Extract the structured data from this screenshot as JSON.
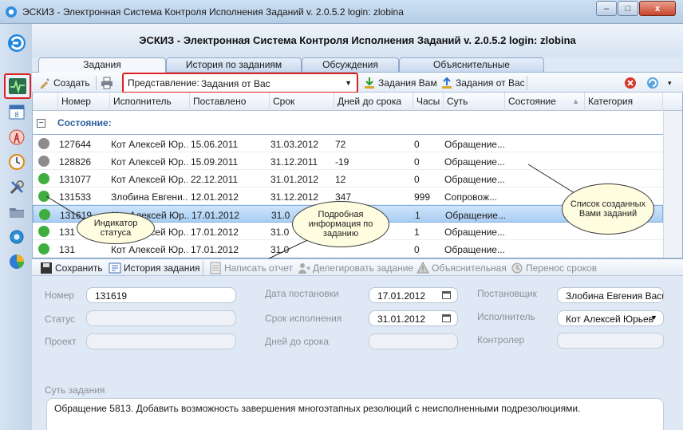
{
  "window": {
    "title": "ЭСКИЗ - Электронная Система Контроля Исполнения Заданий v. 2.0.5.2 login: zlobina",
    "min": "‒",
    "max": "□",
    "close": "x"
  },
  "header": {
    "title": "ЭСКИЗ - Электронная Система Контроля Исполнения Заданий v. 2.0.5.2 login: zlobina"
  },
  "sidebar": {
    "items": [
      {
        "icon": "activity-monitor-icon",
        "active": true
      },
      {
        "icon": "calendar-icon"
      },
      {
        "icon": "antenna-icon"
      },
      {
        "icon": "clock-icon"
      },
      {
        "icon": "tools-icon"
      },
      {
        "icon": "folder-icon"
      },
      {
        "icon": "gear-icon"
      },
      {
        "icon": "pie-chart-icon"
      }
    ]
  },
  "tabs": [
    "Задания",
    "История по заданиям",
    "Обсуждения",
    "Объяснительные"
  ],
  "toolbar": {
    "create": "Создать",
    "view_label": "Представление:",
    "view_value": "Задания от Вас",
    "tasks_to_you": "Задания Вам",
    "tasks_from_you": "Задания от Вас"
  },
  "grid": {
    "columns": [
      "Номер",
      "Исполнитель",
      "Поставлено",
      "Срок",
      "Дней до срока",
      "Часы",
      "Суть",
      "Состояние",
      "Категория"
    ],
    "group_label": "Состояние:",
    "rows": [
      {
        "status": "paused",
        "number": "127644",
        "executor": "Кот Алексей Юр...",
        "set": "15.06.2011",
        "due": "31.03.2012",
        "days": "72",
        "hours": "0",
        "essence": "Обращение..."
      },
      {
        "status": "paused",
        "number": "128826",
        "executor": "Кот Алексей Юр...",
        "set": "15.09.2011",
        "due": "31.12.2011",
        "days": "-19",
        "hours": "0",
        "essence": "Обращение..."
      },
      {
        "status": "active",
        "number": "131077",
        "executor": "Кот Алексей Юр...",
        "set": "22.12.2011",
        "due": "31.01.2012",
        "days": "12",
        "hours": "0",
        "essence": "Обращение..."
      },
      {
        "status": "active",
        "number": "131533",
        "executor": "Злобина Евгени...",
        "set": "12.01.2012",
        "due": "31.12.2012",
        "days": "347",
        "hours": "999",
        "essence": "Сопровож..."
      },
      {
        "status": "active",
        "number": "131619",
        "executor": "Кот Алексей Юр...",
        "set": "17.01.2012",
        "due": "31.0",
        "days": "",
        "hours": "1",
        "essence": "Обращение...",
        "selected": true
      },
      {
        "status": "active",
        "number": "131",
        "executor": "Кот Алексей Юр...",
        "set": "17.01.2012",
        "due": "31.0",
        "days": "",
        "hours": "1",
        "essence": "Обращение..."
      },
      {
        "status": "active",
        "number": "131",
        "executor": "Кот Алексей Юр...",
        "set": "17.01.2012",
        "due": "31.0",
        "days": "",
        "hours": "0",
        "essence": "Обращение..."
      }
    ]
  },
  "callouts": {
    "status_indicator": "Индикатор статуса",
    "details": "Подробная информация по заданию",
    "created_list": "Список созданных Вами заданий"
  },
  "detail_toolbar": {
    "save": "Сохранить",
    "history": "История задания",
    "write_report": "Написать отчет",
    "delegate": "Делегировать задание",
    "explanatory": "Объяснительная",
    "reschedule": "Перенос сроков"
  },
  "form": {
    "number_label": "Номер",
    "number_value": "131619",
    "status_label": "Статус",
    "project_label": "Проект",
    "date_set_label": "Дата постановки",
    "date_set_value": "17.01.2012",
    "deadline_label": "Срок исполнения",
    "deadline_value": "31.01.2012",
    "days_left_label": "Дней до срока",
    "setter_label": "Постановщик",
    "setter_value": "Злобина Евгения Васи",
    "executor_label": "Исполнитель",
    "executor_value": "Кот Алексей Юрьев",
    "controller_label": "Контролер",
    "essence_label": "Суть задания",
    "essence_value": "Обращение 5813. Добавить возможность завершения многоэтапных резолюций с неисполненными подрезолюциями."
  },
  "colors": {
    "highlight_red": "#e02020",
    "group_title": "#2d5e9e",
    "status_active": "#3fae3f",
    "status_paused": "#8c8c8c"
  }
}
